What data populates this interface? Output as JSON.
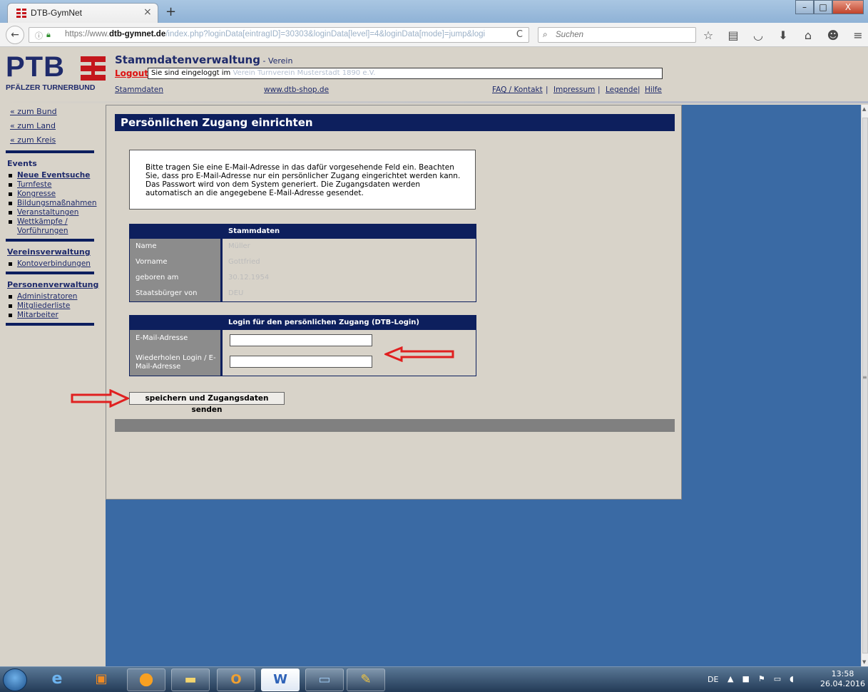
{
  "browser": {
    "tab_title": "DTB-GymNet",
    "tab_close": "×",
    "new_tab": "+",
    "back": "←",
    "info": "ⓘ",
    "lock": "🔒",
    "url_prefix": "https://www.",
    "url_domain": "dtb-gymnet.de",
    "url_path": "/index.php?loginData[eintragID]=30303&loginData[level]=4&loginData[mode]=jump&logi",
    "reload": "C",
    "search_placeholder": "Suchen",
    "toolbar_icons": [
      "star-icon",
      "reading-list-icon",
      "pocket-icon",
      "download-icon",
      "home-icon",
      "emoji-icon",
      "menu-icon"
    ],
    "window_buttons": [
      "–",
      "□",
      "X"
    ]
  },
  "header": {
    "logo_text": "PTB",
    "logo_sub": "PFÄLZER TURNERBUND",
    "title": "Stammdatenverwaltung",
    "title_sub": " - Verein",
    "logout": "Logout",
    "logged_in_text": "Sie sind eingeloggt im",
    "logged_in_blurred": "Verein Turnverein Musterstadt 1890 e.V.",
    "links": {
      "stammdaten": "Stammdaten",
      "shop": "www.dtb-shop.de",
      "faq": "FAQ / Kontakt",
      "impressum": "Impressum",
      "legende": "Legende",
      "hilfe": "Hilfe",
      "sep": "|"
    }
  },
  "sidebar": {
    "nav": [
      "« zum Bund",
      "« zum Land",
      "« zum Kreis"
    ],
    "events_head": "Events",
    "events": [
      "Neue Eventsuche",
      "Turnfeste",
      "Kongresse",
      "Bildungsmaßnahmen",
      "Veranstaltungen",
      "Wettkämpfe / Vorführungen"
    ],
    "verein_head": "Vereinsverwaltung",
    "verein": [
      "Kontoverbindungen"
    ],
    "personen_head": "Personenverwaltung",
    "personen": [
      "Administratoren",
      "Mitgliederliste",
      "Mitarbeiter"
    ]
  },
  "main": {
    "heading": "Persönlichen Zugang einrichten",
    "info": "Bitte tragen Sie eine E-Mail-Adresse in das dafür vorgesehende Feld ein. Beachten Sie, dass pro E-Mail-Adresse nur ein persönlicher Zugang eingerichtet werden kann. Das Passwort wird von dem System generiert. Die Zugangsdaten werden automatisch an die angegebene E-Mail-Adresse gesendet.",
    "stammdaten_head": "Stammdaten",
    "stammdaten_rows": [
      {
        "label": "Name",
        "value": "Müller"
      },
      {
        "label": "Vorname",
        "value": "Gottfried"
      },
      {
        "label": "geboren am",
        "value": "30.12.1954"
      },
      {
        "label": "Staatsbürger von",
        "value": "DEU"
      }
    ],
    "login_head": "Login für den persönlichen Zugang (DTB-Login)",
    "email_label": "E-Mail-Adresse",
    "email_value": "",
    "repeat_label": "Wiederholen Login / E-Mail-Adresse",
    "repeat_value": "",
    "save_button": "speichern und Zugangsdaten senden",
    "annotation_color": "#e02020"
  },
  "taskbar": {
    "apps": [
      "start-orb-icon",
      "internet-explorer-icon",
      "outlook-icon",
      "firefox-icon",
      "file-explorer-icon",
      "outlook-calendar-icon",
      "word-icon",
      "photo-viewer-icon",
      "paint-icon"
    ],
    "word_letter": "W",
    "outlook_letter": "O",
    "ie_letter": "e",
    "lang": "DE",
    "tray_arrow": "▲",
    "time": "13:58",
    "date": "26.04.2016"
  },
  "colors": {
    "navy": "#0d1f5d",
    "page_bg": "#d8d3c9",
    "blue_area": "#3a6aa4",
    "link": "#1e2a6b",
    "red": "#dd1111"
  }
}
